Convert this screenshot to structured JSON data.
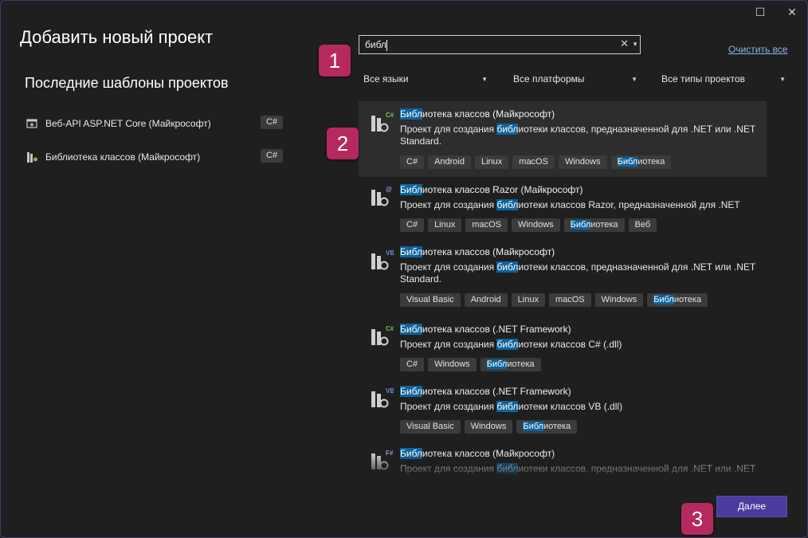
{
  "window": {
    "maximize_glyph": "☐",
    "close_glyph": "✕"
  },
  "page_title": "Добавить новый проект",
  "recent": {
    "title": "Последние шаблоны проектов",
    "items": [
      {
        "label": "Веб-API ASP.NET Core (Майкрософт)",
        "lang": "C#",
        "icon": "web-api-icon"
      },
      {
        "label": "Библиотека классов (Майкрософт)",
        "lang": "C#",
        "icon": "class-library-icon"
      }
    ]
  },
  "search": {
    "value": "библ",
    "clear_glyph": "✕",
    "dropdown_glyph": "▼"
  },
  "clear_all": "Очистить все",
  "filters": {
    "languages": "Все языки",
    "platforms": "Все платформы",
    "project_types": "Все типы проектов",
    "arrow": "▼"
  },
  "badges": [
    "1",
    "2",
    "3"
  ],
  "results": [
    {
      "hl": "Библ",
      "title_rest": "иотека классов (Майкрософт)",
      "desc_pre": "Проект для создания ",
      "desc_hl": "библ",
      "desc_post": "иотеки классов, предназначенной для .NET или .NET Standard.",
      "lang_badge": "C#",
      "lang_color": "#7dbb5e",
      "tags": [
        {
          "hl": "",
          "text": "C#"
        },
        {
          "hl": "",
          "text": "Android"
        },
        {
          "hl": "",
          "text": "Linux"
        },
        {
          "hl": "",
          "text": "macOS"
        },
        {
          "hl": "",
          "text": "Windows"
        },
        {
          "hl": "Библ",
          "text": "иотека"
        }
      ]
    },
    {
      "hl": "Библ",
      "title_rest": "иотека классов Razor (Майкрософт)",
      "desc_pre": "Проект для создания ",
      "desc_hl": "библ",
      "desc_post": "иотеки классов Razor, предназначенной для .NET",
      "lang_badge": "@",
      "lang_color": "#b48ee0",
      "tags": [
        {
          "hl": "",
          "text": "C#"
        },
        {
          "hl": "",
          "text": "Linux"
        },
        {
          "hl": "",
          "text": "macOS"
        },
        {
          "hl": "",
          "text": "Windows"
        },
        {
          "hl": "Библ",
          "text": "иотека"
        },
        {
          "hl": "",
          "text": "Веб"
        }
      ]
    },
    {
      "hl": "Библ",
      "title_rest": "иотека классов (Майкрософт)",
      "desc_pre": "Проект для создания ",
      "desc_hl": "библ",
      "desc_post": "иотеки классов, предназначенной для .NET или .NET Standard.",
      "lang_badge": "VB",
      "lang_color": "#6a8fdb",
      "tags": [
        {
          "hl": "",
          "text": "Visual Basic"
        },
        {
          "hl": "",
          "text": "Android"
        },
        {
          "hl": "",
          "text": "Linux"
        },
        {
          "hl": "",
          "text": "macOS"
        },
        {
          "hl": "",
          "text": "Windows"
        },
        {
          "hl": "Библ",
          "text": "иотека"
        }
      ]
    },
    {
      "hl": "Библ",
      "title_rest": "иотека классов (.NET Framework)",
      "desc_pre": "Проект для создания ",
      "desc_hl": "библ",
      "desc_post": "иотеки классов C# (.dll)",
      "lang_badge": "C#",
      "lang_color": "#7dbb5e",
      "tags": [
        {
          "hl": "",
          "text": "C#"
        },
        {
          "hl": "",
          "text": "Windows"
        },
        {
          "hl": "Библ",
          "text": "иотека"
        }
      ]
    },
    {
      "hl": "Библ",
      "title_rest": "иотека классов (.NET Framework)",
      "desc_pre": "Проект для создания ",
      "desc_hl": "библ",
      "desc_post": "иотеки классов VB (.dll)",
      "lang_badge": "VB",
      "lang_color": "#6a8fdb",
      "tags": [
        {
          "hl": "",
          "text": "Visual Basic"
        },
        {
          "hl": "",
          "text": "Windows"
        },
        {
          "hl": "Библ",
          "text": "иотека"
        }
      ]
    },
    {
      "hl": "Библ",
      "title_rest": "иотека классов (Майкрософт)",
      "desc_pre": "Проект для создания ",
      "desc_hl": "библ",
      "desc_post": "иотеки классов, предназначенной для .NET или .NET",
      "lang_badge": "F#",
      "lang_color": "#b48ee0",
      "tags": []
    }
  ],
  "next_button": "Далее",
  "colors": {
    "background": "#1f1f1f",
    "accent_badge": "#b5295e",
    "highlight": "#0e639c",
    "primary_button": "#4b3b9c",
    "link": "#8fb4f0"
  }
}
